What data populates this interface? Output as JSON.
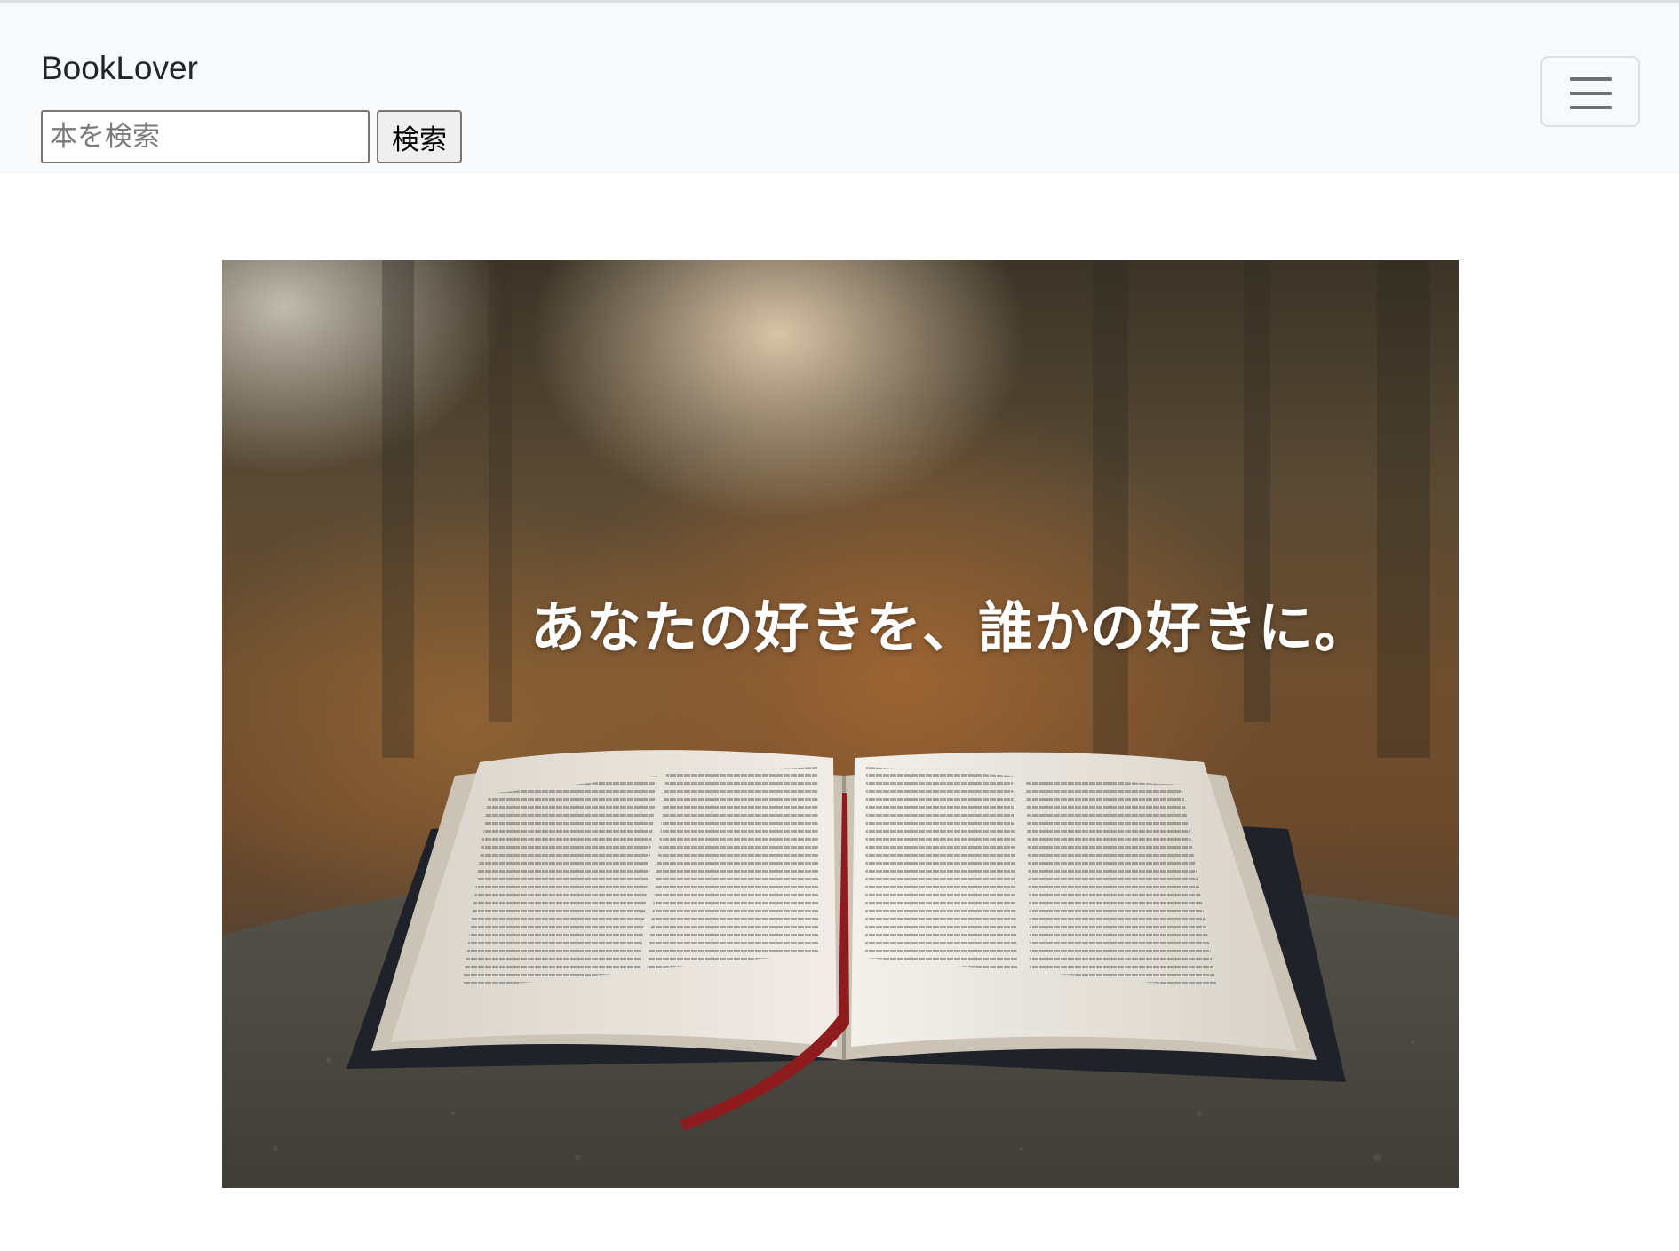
{
  "navbar": {
    "brand": "BookLover",
    "search": {
      "placeholder": "本を検索",
      "value": "",
      "button_label": "検索"
    },
    "toggler_icon": "hamburger-menu-icon"
  },
  "hero": {
    "catchphrase": "あなたの好きを、誰かの好きに。",
    "image_subject": "open-book-on-rock-autumn-forest"
  },
  "colors": {
    "navbar_bg": "#f8f9fa",
    "brand_text": "#212529",
    "catchphrase_text": "#ffffff"
  }
}
